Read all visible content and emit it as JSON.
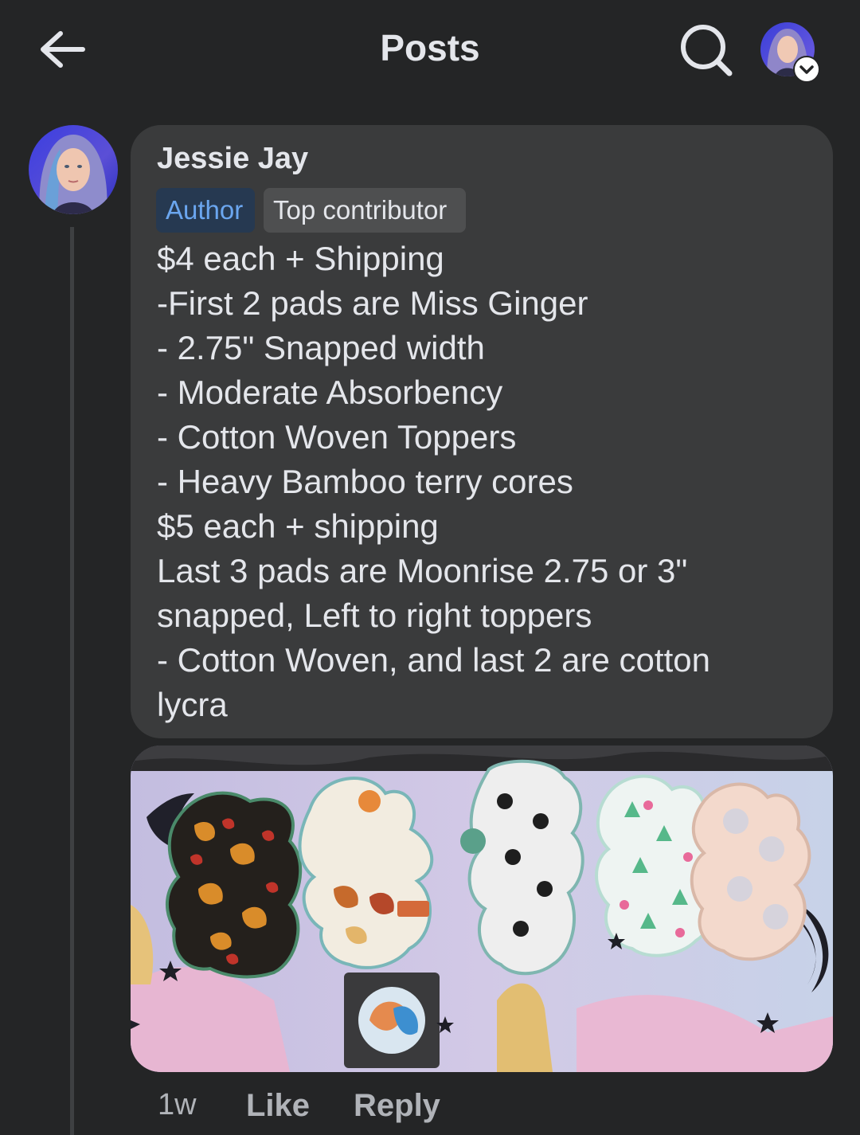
{
  "header": {
    "title": "Posts",
    "back_icon": "arrow-left-icon",
    "search_icon": "search-icon",
    "profile_icon": "chevron-down-icon"
  },
  "comment": {
    "author": "Jessie Jay",
    "badges": [
      "Author",
      "Top contributor"
    ],
    "body": "$4 each + Shipping\n-First 2 pads are Miss Ginger\n- 2.75\" Snapped width\n- Moderate Absorbency\n- Cotton Woven Toppers\n- Heavy Bamboo terry cores\n$5 each + shipping\nLast 3 pads are Moonrise 2.75 or 3\"\nsnapped, Left to right toppers\n- Cotton Woven, and last 2 are cotton\nlycra",
    "time": "1w",
    "like_label": "Like",
    "reply_label": "Reply"
  },
  "colors": {
    "background": "#242526",
    "bubble": "#3a3b3c",
    "author_badge_bg": "#263951",
    "author_badge_text": "#6ba6ef",
    "secondary_text": "#b0b3b8"
  }
}
